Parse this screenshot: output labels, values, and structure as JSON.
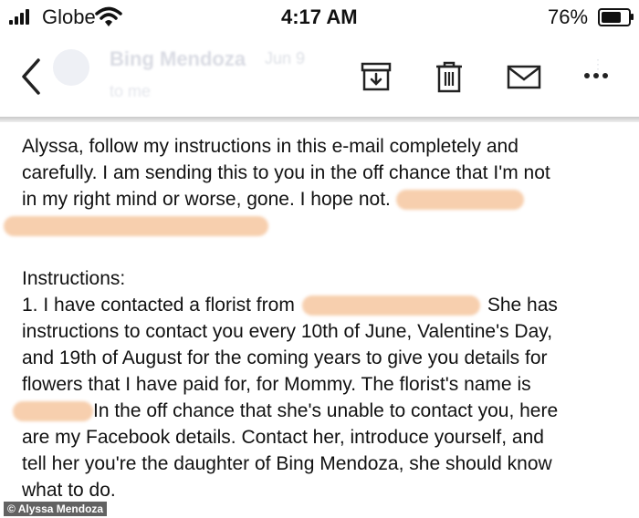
{
  "status_bar": {
    "carrier": "Globe",
    "time": "4:17 AM",
    "battery_percent": "76%",
    "battery_level": 0.76,
    "icons": [
      "cellular-signal-icon",
      "wifi-icon",
      "battery-icon"
    ]
  },
  "toolbar": {
    "sender_name": "Bing Mendoza",
    "sender_date": "Jun 9",
    "recipient": "to me",
    "icons": [
      "back-arrow-icon",
      "archive-icon",
      "trash-icon",
      "mail-icon",
      "more-vertical-icon",
      "more-horizontal-icon"
    ]
  },
  "email": {
    "p1": [
      "Alyssa, follow my instructions in this e-mail completely and",
      "carefully. I am sending this to you in the off chance that I'm not",
      "in my right mind or worse, gone. I hope not."
    ],
    "instructions_heading": "Instructions:",
    "item1_prefix": "1. I have contacted a florist from",
    "item1_suffix": "She has",
    "item1_lines": [
      "instructions to contact you every 10th of June, Valentine's Day,",
      "and 19th of August for the coming years to give you details for",
      "flowers that I have paid for, for Mommy. The florist's name is"
    ],
    "item1_name_line": "In the off chance that she's unable to contact you, here",
    "item1_tail": [
      "are my Facebook details. Contact her, introduce yourself, and",
      "tell her you're the daughter of Bing Mendoza, she should know",
      "what to do."
    ]
  },
  "credit": "© Alyssa Mendoza"
}
